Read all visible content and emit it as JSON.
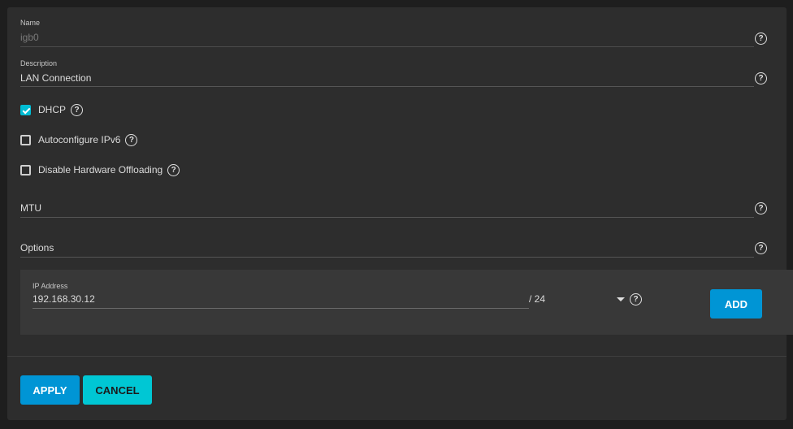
{
  "form": {
    "name": {
      "label": "Name",
      "value": "igb0"
    },
    "description": {
      "label": "Description",
      "value": "LAN Connection"
    },
    "dhcp": {
      "label": "DHCP",
      "checked": true
    },
    "autoconfigure_ipv6": {
      "label": "Autoconfigure IPv6",
      "checked": false
    },
    "disable_hw_offloading": {
      "label": "Disable Hardware Offloading",
      "checked": false
    },
    "mtu": {
      "placeholder": "MTU",
      "value": ""
    },
    "options": {
      "placeholder": "Options",
      "value": ""
    },
    "ip_address": {
      "label": "IP Address",
      "value": "192.168.30.12",
      "netmask": "/ 24"
    },
    "add_label": "ADD",
    "apply_label": "APPLY",
    "cancel_label": "CANCEL",
    "help_glyph": "?"
  },
  "colors": {
    "primary": "#0095d5",
    "accent": "#00c7d4",
    "panel": "#2d2d2d"
  },
  "icons": {
    "help": "help-circle-icon",
    "dropdown": "caret-down-icon",
    "check": "checkmark-icon"
  }
}
